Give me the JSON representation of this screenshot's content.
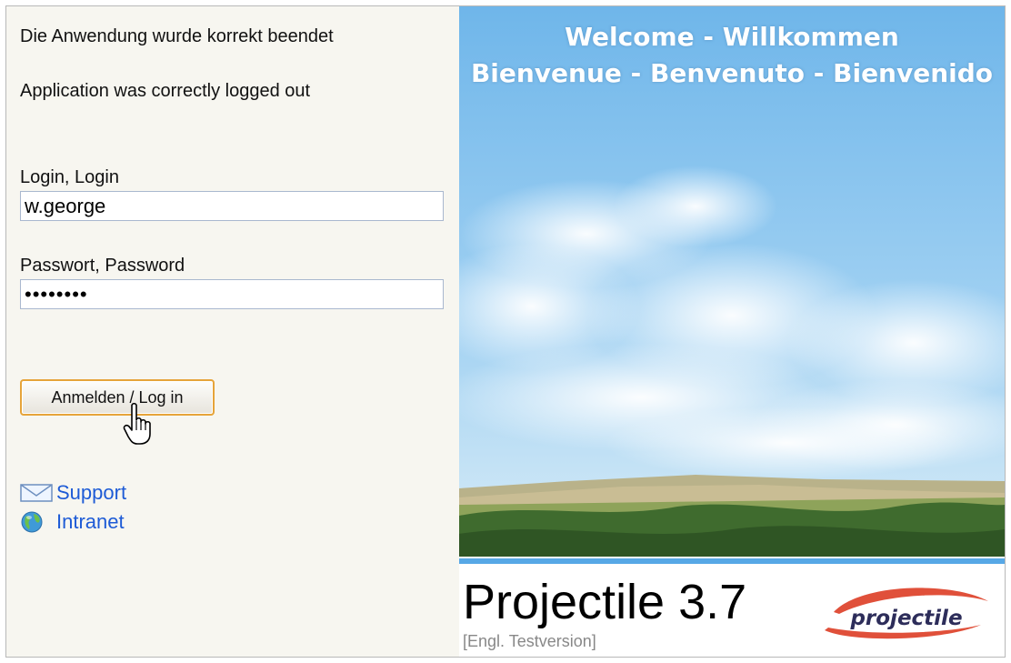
{
  "messages": {
    "de": "Die Anwendung wurde korrekt beendet",
    "en": "Application was correctly logged out"
  },
  "login": {
    "label": "Login, Login",
    "value": "w.george"
  },
  "password": {
    "label": "Passwort, Password",
    "value": "••••••••"
  },
  "button": {
    "label": "Anmelden / Log in"
  },
  "links": [
    {
      "label": "Support",
      "icon": "envelope-icon"
    },
    {
      "label": "Intranet",
      "icon": "globe-icon"
    }
  ],
  "banner": {
    "line1": "Welcome - Willkommen",
    "line2": "Bienvenue - Benvenuto - Bienvenido"
  },
  "product": {
    "name": "Projectile 3.7",
    "version_note": "[Engl. Testversion]",
    "logo_text": "projectile"
  },
  "colors": {
    "left_bg": "#f7f6f0",
    "link": "#1e5bd6",
    "button_border": "#e6a43a",
    "band": "#57a8e6",
    "logo_swoosh": "#e0503a"
  }
}
